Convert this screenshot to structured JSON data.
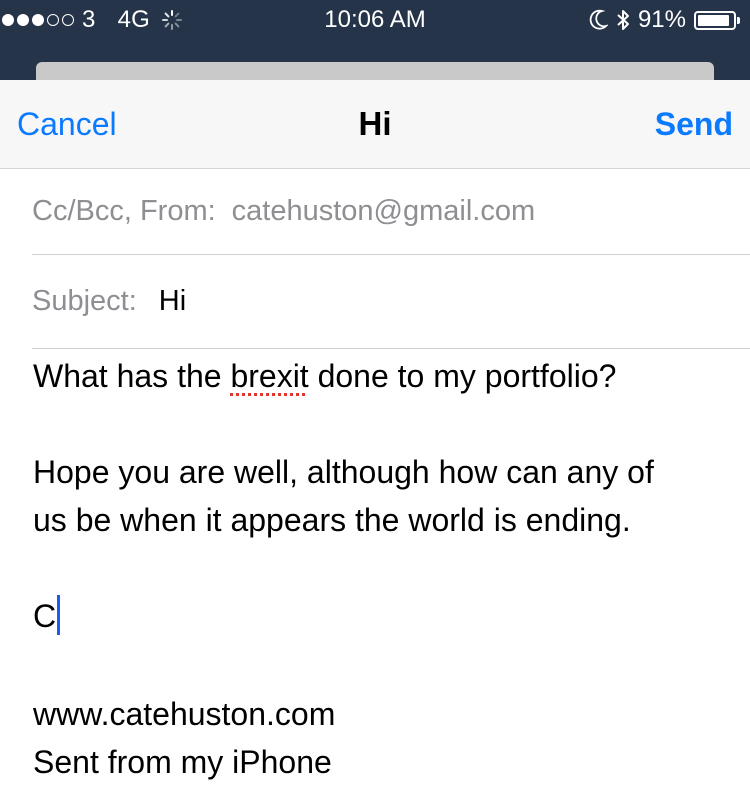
{
  "status_bar": {
    "carrier": "3",
    "network": "4G",
    "signal_filled": 3,
    "signal_total": 5,
    "time": "10:06 AM",
    "battery": "91%",
    "battery_level": 0.91,
    "icons": [
      "activity-spinner-icon",
      "moon-icon",
      "bluetooth-icon",
      "battery-icon"
    ],
    "background": "#253448"
  },
  "nav": {
    "cancel_label": "Cancel",
    "title": "Hi",
    "send_label": "Send",
    "accent": "#0a7aff"
  },
  "fields": {
    "ccbcc_label": "Cc/Bcc, From:",
    "from_value": "catehuston@gmail.com",
    "subject_label": "Subject:",
    "subject_value": "Hi"
  },
  "body": {
    "line1_before": "What has the ",
    "line1_misspelled": "brexit",
    "line1_after": " done to my portfolio?",
    "line2": "Hope you are well, although how can any of",
    "line3": "us be when it appears the world is ending.",
    "signoff": "C",
    "signature_url": "www.catehuston.com",
    "signature_sent": "Sent from my iPhone"
  }
}
